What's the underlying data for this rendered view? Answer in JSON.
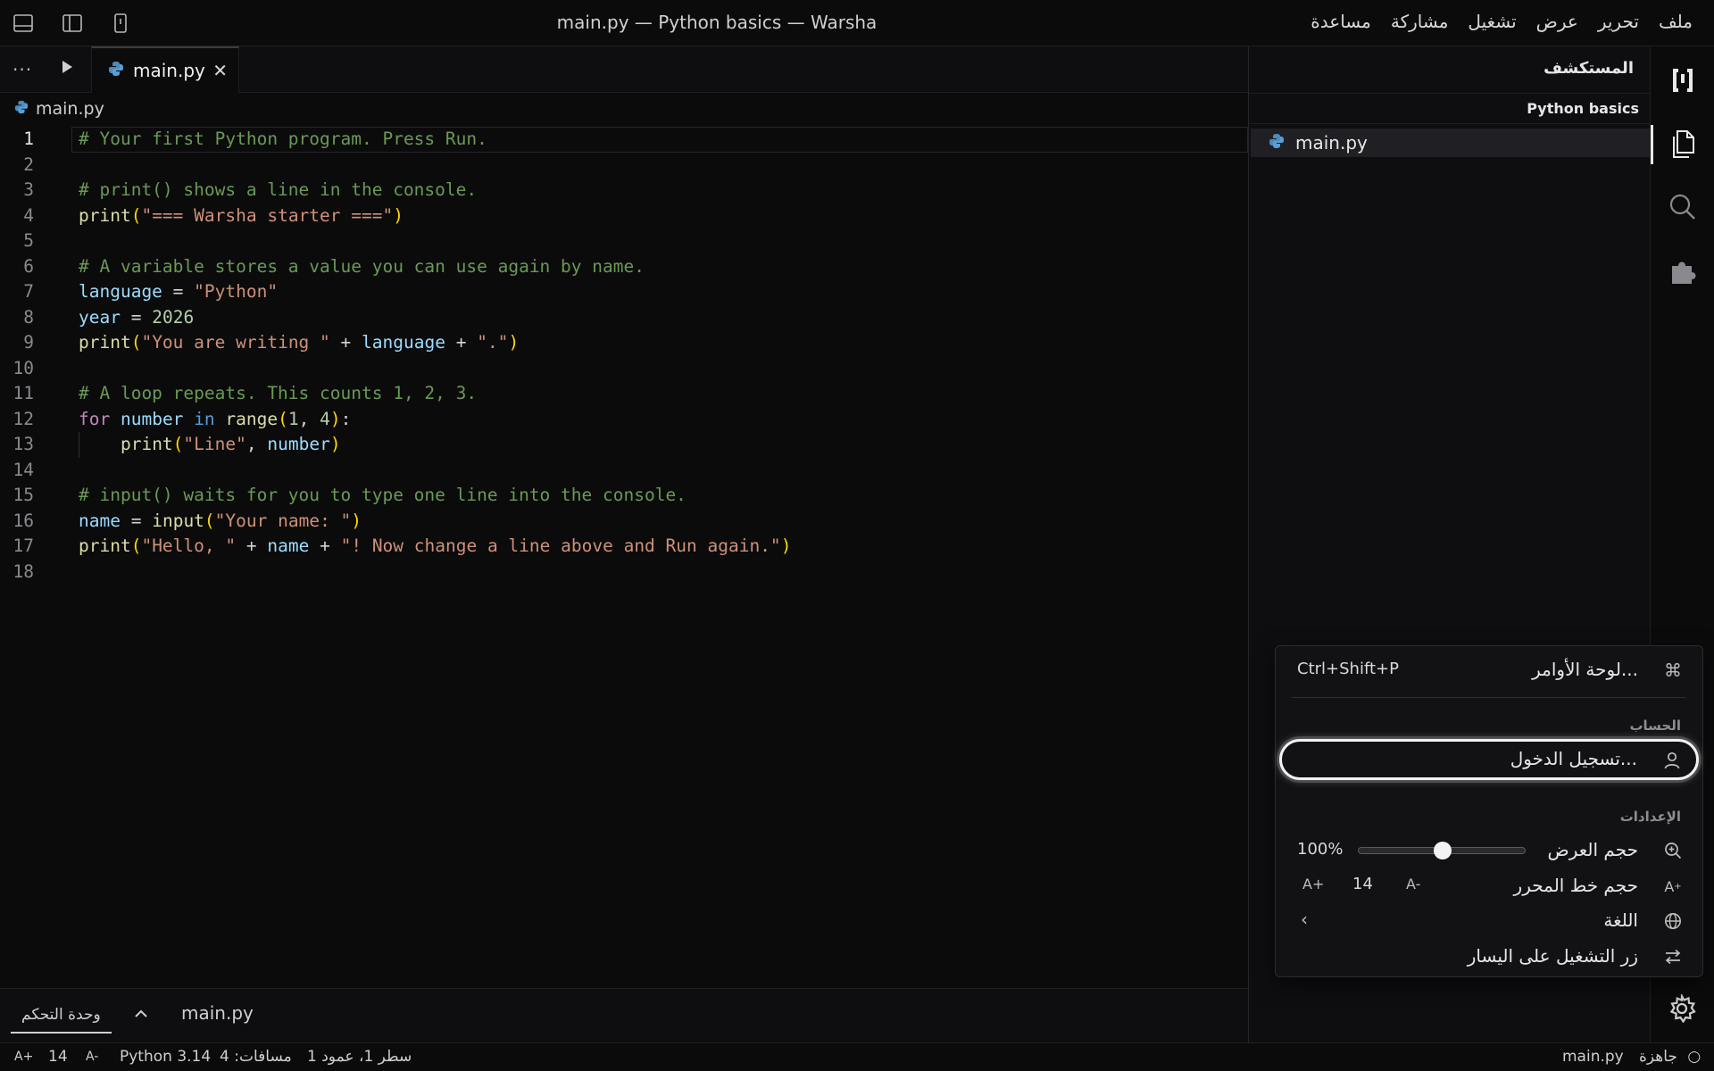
{
  "window": {
    "title": "main.py — Python basics — Warsha"
  },
  "menu": [
    "ملف",
    "تحرير",
    "عرض",
    "تشغيل",
    "مشاركة",
    "مساعدة"
  ],
  "explorer": {
    "title": "المستكشف",
    "project": "Python basics",
    "files": [
      "main.py"
    ]
  },
  "editor": {
    "tab_label": "main.py",
    "breadcrumb": "main.py",
    "current_line": 1,
    "lines": [
      "# Your first Python program. Press Run.",
      "",
      "# print() shows a line in the console.",
      "print(\"=== Warsha starter ===\")",
      "",
      "# A variable stores a value you can use again by name.",
      "language = \"Python\"",
      "year = 2026",
      "print(\"You are writing \" + language + \".\")",
      "",
      "# A loop repeats. This counts 1, 2, 3.",
      "for number in range(1, 4):",
      "    print(\"Line\", number)",
      "",
      "# input() waits for you to type one line into the console.",
      "name = input(\"Your name: \")",
      "print(\"Hello, \" + name + \"! Now change a line above and Run again.\")",
      ""
    ]
  },
  "panel": {
    "console_tab": "وحدة التحكم",
    "file": "main.py"
  },
  "settings_menu": {
    "command_palette": {
      "label": "لوحة الأوامر...",
      "shortcut": "Ctrl+Shift+P"
    },
    "account_section": "الحساب",
    "sign_in": "تسجيل الدخول...",
    "settings_section": "الإعدادات",
    "zoom": {
      "label": "حجم العرض",
      "value": "100%",
      "level": 0.5
    },
    "editor_font": {
      "label": "حجم خط المحرر",
      "value": "14",
      "increase": "A+",
      "decrease": "A-"
    },
    "language": {
      "label": "اللغة"
    },
    "run_button_left": {
      "label": "زر التشغيل على اليسار"
    }
  },
  "statusbar": {
    "ready": "جاهزة",
    "file": "main.py",
    "position": "سطر 1، عمود 1",
    "spaces": "مسافات: 4",
    "python": "Python 3.14",
    "font_decrease": "A-",
    "font_size": "14",
    "font_increase": "A+"
  }
}
